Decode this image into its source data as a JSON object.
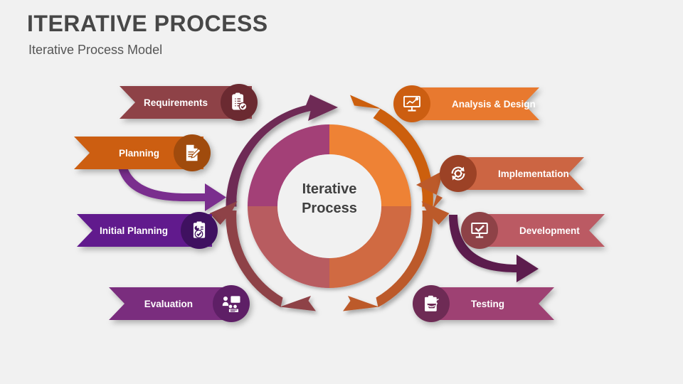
{
  "header": {
    "title": "ITERATIVE PROCESS",
    "subtitle": "Iterative Process Model"
  },
  "center": {
    "line1": "Iterative",
    "line2": "Process"
  },
  "colors": {
    "background": "#f1f1f1",
    "title_text": "#474747",
    "subtitle_text": "#555555",
    "center_text": "#404040"
  },
  "left_items": [
    {
      "label": "Requirements",
      "banner_color": "#8E4247",
      "circle_color": "#6B2A31",
      "icon": "clipboard-check-icon"
    },
    {
      "label": "Planning",
      "banner_color": "#CC5E11",
      "circle_color": "#A04B0D",
      "icon": "document-pencil-icon"
    },
    {
      "label": "Initial Planning",
      "banner_color": "#611A8D",
      "circle_color": "#3F1160",
      "icon": "clipboard-report-icon"
    },
    {
      "label": "Evaluation",
      "banner_color": "#7A2D7E",
      "circle_color": "#5E1F66",
      "icon": "presentation-people-icon"
    }
  ],
  "right_items": [
    {
      "label": "Analysis & Design",
      "banner_color": "#E8792F",
      "circle_color": "#CC5E11",
      "icon": "chart-board-icon"
    },
    {
      "label": "Implementation",
      "banner_color": "#CC6543",
      "circle_color": "#9C4226",
      "icon": "gear-cycle-icon"
    },
    {
      "label": "Development",
      "banner_color": "#BB5A63",
      "circle_color": "#8E4247",
      "icon": "board-check-icon"
    },
    {
      "label": "Testing",
      "banner_color": "#9E4173",
      "circle_color": "#6E2B55",
      "icon": "clipboard-basket-icon"
    }
  ],
  "donut": {
    "segments": [
      {
        "name": "top-left",
        "color": "#A34077"
      },
      {
        "name": "top-right",
        "color": "#EE8234"
      },
      {
        "name": "bottom-right",
        "color": "#D06A43"
      },
      {
        "name": "bottom-left",
        "color": "#B85B60"
      }
    ]
  },
  "outer_arcs": [
    {
      "name": "arc-top-left",
      "color": "#6E2B55"
    },
    {
      "name": "arc-top-right",
      "color": "#CC5E11"
    },
    {
      "name": "arc-bottom-right",
      "color": "#BC5A2B"
    },
    {
      "name": "arc-bottom-left",
      "color": "#8E4247"
    }
  ],
  "connector_arrows": [
    {
      "name": "left-connector-arrow",
      "color": "#7A2D8E"
    },
    {
      "name": "right-connector-arrow",
      "color": "#5C1F4E"
    }
  ]
}
